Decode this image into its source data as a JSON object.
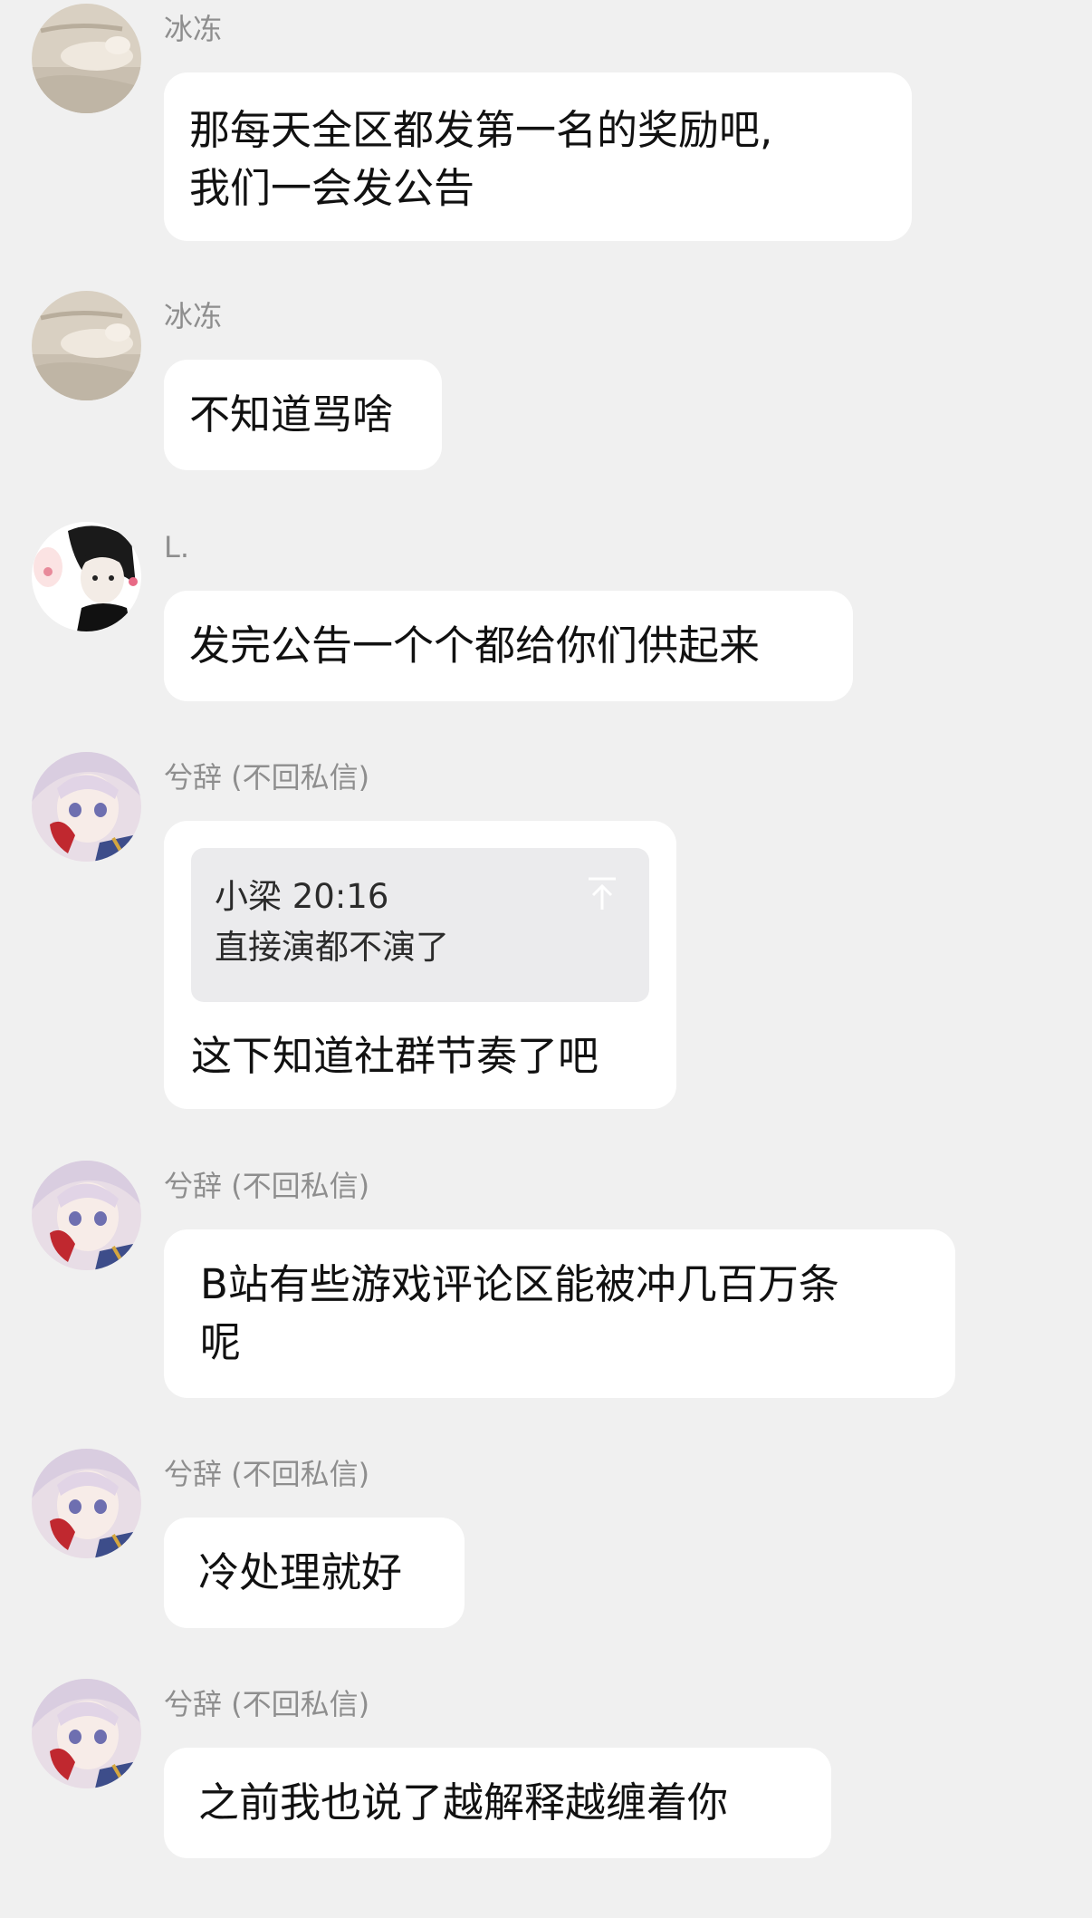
{
  "colors": {
    "background": "#f0f0f0",
    "bubble": "#ffffff",
    "quote_box": "#ebebed",
    "sender_name": "#8e8e8e"
  },
  "messages": [
    {
      "sender": "冰冻",
      "avatar": "cat-avatar",
      "lines": [
        "那每天全区都发第一名的奖励吧,",
        "我们一会发公告"
      ]
    },
    {
      "sender": "冰冻",
      "avatar": "cat-avatar",
      "lines": [
        "不知道骂啥"
      ]
    },
    {
      "sender": "L.",
      "avatar": "anime-boy-avatar",
      "lines": [
        "发完公告一个个都给你们供起来"
      ]
    },
    {
      "sender": "兮辞 (不回私信)",
      "avatar": "anime-girl-avatar",
      "quote": {
        "author_time": "小梁 20:16",
        "text": "直接演都不演了",
        "icon": "jump-to-original-icon"
      },
      "lines": [
        "这下知道社群节奏了吧"
      ]
    },
    {
      "sender": "兮辞 (不回私信)",
      "avatar": "anime-girl-avatar",
      "lines": [
        "B站有些游戏评论区能被冲几百万条",
        "呢"
      ]
    },
    {
      "sender": "兮辞 (不回私信)",
      "avatar": "anime-girl-avatar",
      "lines": [
        "冷处理就好"
      ]
    },
    {
      "sender": "兮辞 (不回私信)",
      "avatar": "anime-girl-avatar",
      "lines": [
        "之前我也说了越解释越缠着你"
      ]
    }
  ]
}
